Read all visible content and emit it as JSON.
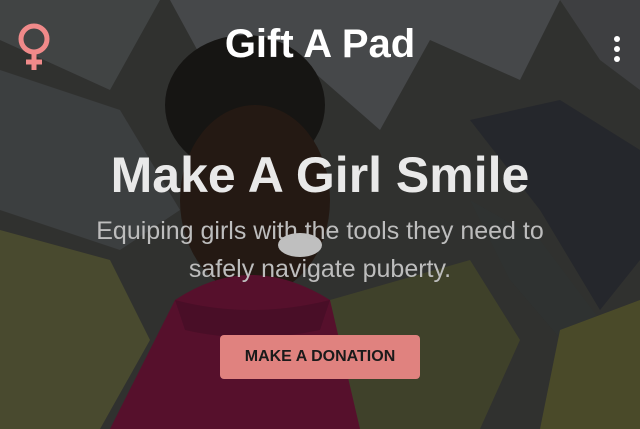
{
  "header": {
    "logo_icon": "female-symbol-icon",
    "title": "Gift A Pad",
    "menu_icon": "more-vertical-icon"
  },
  "hero": {
    "headline": "Make A Girl Smile",
    "subtitle": "Equiping girls with the tools they need to safely navigate puberty.",
    "cta_label": "MAKE A DONATION"
  },
  "colors": {
    "accent": "#e0827f",
    "logo": "#f08a8a",
    "headline": "#e9e9e9",
    "subtitle": "#bdbdbd"
  }
}
